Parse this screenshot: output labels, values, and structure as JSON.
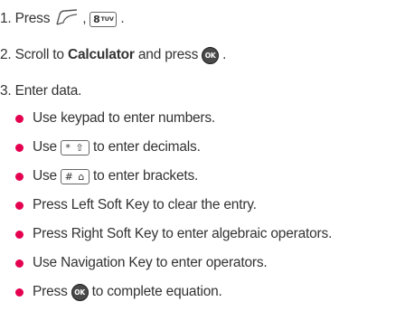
{
  "steps": [
    {
      "num": "1.",
      "before": "Press",
      "comma": ",",
      "end": ".",
      "key8": {
        "main": "8",
        "sub": "TUV"
      }
    },
    {
      "num": "2.",
      "before": "Scroll to",
      "bold": "Calculator",
      "mid": "and press",
      "end": ".",
      "ok": "OK"
    },
    {
      "num": "3.",
      "text": "Enter data."
    }
  ],
  "bullets": [
    {
      "text": "Use keypad to enter numbers."
    },
    {
      "before": "Use",
      "key": "* ⇧",
      "after": "to enter decimals."
    },
    {
      "before": "Use",
      "key": "# ⌂",
      "after": "to enter brackets."
    },
    {
      "text": "Press Left Soft Key to clear the entry."
    },
    {
      "text": "Press Right Soft Key to enter algebraic operators."
    },
    {
      "text": "Use Navigation Key to enter operators."
    },
    {
      "before": "Press",
      "ok": "OK",
      "after": "to complete equation."
    }
  ],
  "colors": {
    "bullet": "#e4004f",
    "text": "#333333"
  },
  "icons": [
    "menu-key-icon",
    "ok-key-icon",
    "key-8-icon",
    "star-key-icon",
    "hash-key-icon"
  ]
}
